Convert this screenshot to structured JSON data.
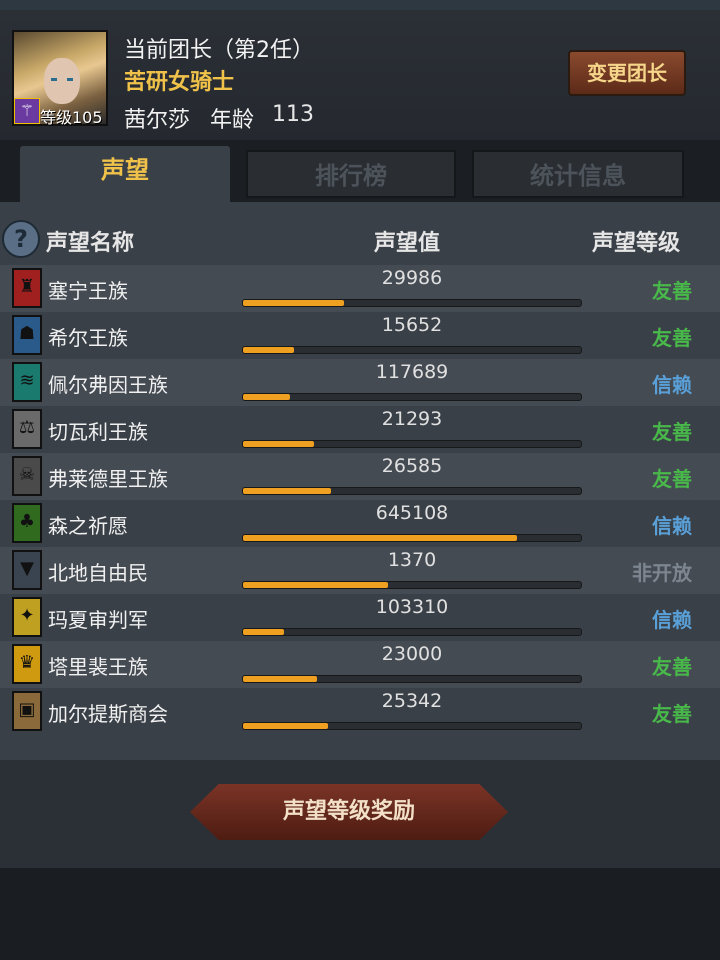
{
  "leader": {
    "title": "当前团长（第2任）",
    "class_name": "苦研女骑士",
    "level_label": "等级105",
    "name": "茜尔莎",
    "age_label": "年龄",
    "age": "113",
    "change_button": "变更团长",
    "level_icon": "wand-icon"
  },
  "tabs": [
    {
      "label": "声望",
      "active": true
    },
    {
      "label": "排行榜",
      "active": false
    },
    {
      "label": "统计信息",
      "active": false
    }
  ],
  "columns": {
    "name": "声望名称",
    "value": "声望值",
    "level": "声望等级"
  },
  "level_colors": {
    "友善": "#49b84a",
    "信赖": "#5aa0d8",
    "非开放": "#7d8690"
  },
  "factions": [
    {
      "name": "塞宁王族",
      "value": "29986",
      "progress": 0.3,
      "level": "友善",
      "crest_color": "#a02020",
      "crest_icon": "crown-icon"
    },
    {
      "name": "希尔王族",
      "value": "15652",
      "progress": 0.15,
      "level": "友善",
      "crest_color": "#2a5a8a",
      "crest_icon": "helmet-icon"
    },
    {
      "name": "佩尔弗因王族",
      "value": "117689",
      "progress": 0.14,
      "level": "信赖",
      "crest_color": "#1a7a6e",
      "crest_icon": "wave-icon"
    },
    {
      "name": "切瓦利王族",
      "value": "21293",
      "progress": 0.21,
      "level": "友善",
      "crest_color": "#6a6a6a",
      "crest_icon": "scales-icon"
    },
    {
      "name": "弗莱德里王族",
      "value": "26585",
      "progress": 0.26,
      "level": "友善",
      "crest_color": "#4a4a4a",
      "crest_icon": "skull-icon"
    },
    {
      "name": "森之祈愿",
      "value": "645108",
      "progress": 0.81,
      "level": "信赖",
      "crest_color": "#2f6a1e",
      "crest_icon": "tree-icon"
    },
    {
      "name": "北地自由民",
      "value": "1370",
      "progress": 0.43,
      "level": "非开放",
      "crest_color": "#3a4450",
      "crest_icon": "wolf-icon"
    },
    {
      "name": "玛夏审判军",
      "value": "103310",
      "progress": 0.12,
      "level": "信赖",
      "crest_color": "#c0a020",
      "crest_icon": "wings-icon"
    },
    {
      "name": "塔里裴王族",
      "value": "23000",
      "progress": 0.22,
      "level": "友善",
      "crest_color": "#d09a10",
      "crest_icon": "lion-icon"
    },
    {
      "name": "加尔提斯商会",
      "value": "25342",
      "progress": 0.25,
      "level": "友善",
      "crest_color": "#8a6a3a",
      "crest_icon": "chest-icon"
    }
  ],
  "reward_button": "声望等级奖励"
}
